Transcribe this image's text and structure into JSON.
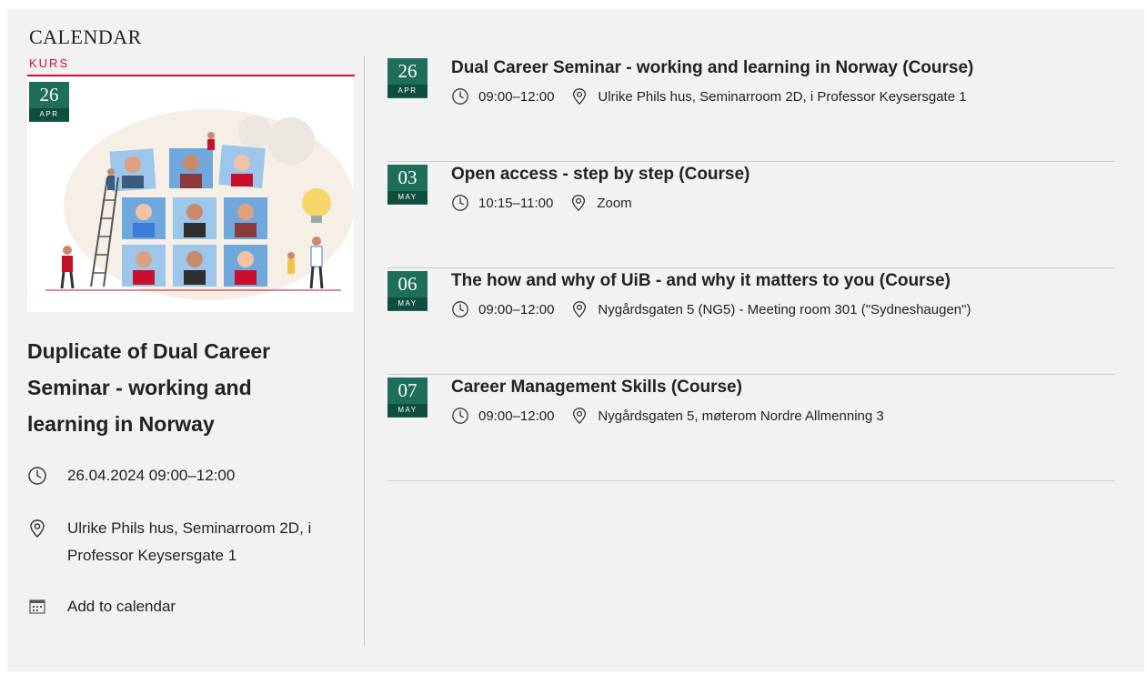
{
  "calendar": {
    "heading": "CALENDAR",
    "category": "KURS"
  },
  "featured": {
    "date": {
      "day": "26",
      "month": "APR"
    },
    "title": "Duplicate of Dual Career Seminar - working and learning in Norway",
    "datetime": "26.04.2024 09:00–12:00",
    "location": "Ulrike Phils hus, Seminarroom 2D, i Professor Keysersgate 1",
    "add_to_calendar": "Add to calendar"
  },
  "events": [
    {
      "day": "26",
      "month": "APR",
      "title": "Dual Career Seminar - working and learning in Norway (Course)",
      "time": "09:00–12:00",
      "location": "Ulrike Phils hus, Seminarroom 2D, i Professor Keysersgate 1"
    },
    {
      "day": "03",
      "month": "MAY",
      "title": "Open access - step by step (Course)",
      "time": "10:15–11:00",
      "location": "Zoom"
    },
    {
      "day": "06",
      "month": "MAY",
      "title": "The how and why of UiB - and why it matters to you (Course)",
      "time": "09:00–12:00",
      "location": "Nygårdsgaten 5 (NG5) - Meeting room 301 (\"Sydneshaugen\")"
    },
    {
      "day": "07",
      "month": "MAY",
      "title": "Career Management Skills (Course)",
      "time": "09:00–12:00",
      "location": "Nygårdsgaten 5, møterom Nordre Allmenning 3"
    }
  ],
  "colors": {
    "accent_red": "#c8102e",
    "badge_green": "#1f6e5a",
    "badge_green_dark": "#0f4e3e",
    "panel_bg": "#f2f2f2"
  },
  "icons": {
    "time": "clock-icon",
    "location": "map-pin-icon",
    "calendar": "calendar-add-icon"
  }
}
